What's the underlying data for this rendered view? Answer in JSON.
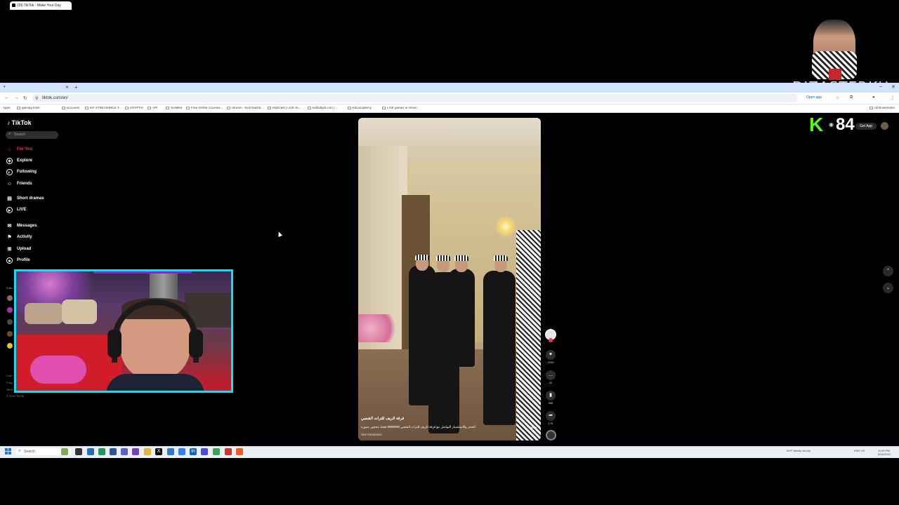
{
  "browser": {
    "tab_title": "(39) TikTok - Make Your Day",
    "url": "tiktok.com/en/",
    "open_app_label": "Open app",
    "bookmarks": [
      {
        "label": "Apps"
      },
      {
        "label": "gaming tools"
      },
      {
        "label": "accounts"
      },
      {
        "label": "MY STREAMINGS T..."
      },
      {
        "label": "CRYPTO"
      },
      {
        "label": "API"
      },
      {
        "label": "GAMES"
      },
      {
        "label": "Free Online Courses..."
      },
      {
        "label": "Stream - Kick Dashb..."
      },
      {
        "label": "Multicast | LIVE St..."
      },
      {
        "label": "kofindipal.com | ..."
      },
      {
        "label": "Kikoocademy"
      },
      {
        "label": "LIVE games in Vision"
      }
    ],
    "all_bookmarks_label": "All Bookmarks"
  },
  "tiktok": {
    "logo": "TikTok",
    "search_placeholder": "Search",
    "nav": [
      {
        "label": "For You",
        "icon": "home-icon"
      },
      {
        "label": "Explore",
        "icon": "compass-icon"
      },
      {
        "label": "Following",
        "icon": "following-icon"
      },
      {
        "label": "Friends",
        "icon": "friends-icon"
      },
      {
        "label": "Short dramas",
        "icon": "drama-icon"
      },
      {
        "label": "LIVE",
        "icon": "live-icon"
      },
      {
        "label": "Messages",
        "icon": "messages-icon"
      },
      {
        "label": "Activity",
        "icon": "activity-icon"
      },
      {
        "label": "Upload",
        "icon": "upload-icon"
      },
      {
        "label": "Profile",
        "icon": "profile-icon"
      }
    ],
    "following_label": "Follo",
    "footer": [
      "Com",
      "Prog",
      "Term",
      "© 2024 TikTok"
    ],
    "get_app_label": "Get App"
  },
  "video": {
    "caption": "فرقة الريف للتراث الشعبي",
    "description": "للحجز والاستفسار التواصل مع فرقة الريف للتراث الشعبي 9999999 فقط محجوز عمورة",
    "more_label": "more",
    "see_translation": "See translation",
    "likes": "2259",
    "comments": "22",
    "saves": "396",
    "shares": "176"
  },
  "overlay": {
    "viewer_count": "84",
    "streamer_name": "DIZASTERKH"
  },
  "taskbar": {
    "search_placeholder": "Search",
    "weather": "59°F Mostly cloudy",
    "lang": "ENG US",
    "time": "11:59 PM",
    "date": "8/18/2024"
  },
  "colors": {
    "accent": "#fe2c55",
    "webcam_border": "#18dbf0",
    "kick_green": "#53fc18"
  }
}
